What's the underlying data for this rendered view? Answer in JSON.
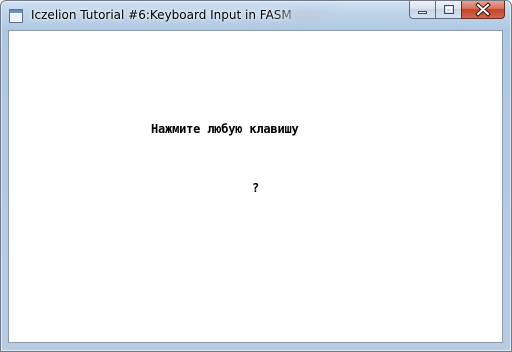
{
  "window": {
    "title": "Iczelion Tutorial #6:Keyboard Input in FASM",
    "icon": "application-window-icon"
  },
  "caption_buttons": {
    "minimize_icon": "minimize-icon",
    "maximize_icon": "maximize-icon",
    "close_icon": "close-icon",
    "close_color": "#c2432b"
  },
  "client": {
    "prompt": "Нажмите любую клавишу",
    "pressed_key": "?"
  }
}
